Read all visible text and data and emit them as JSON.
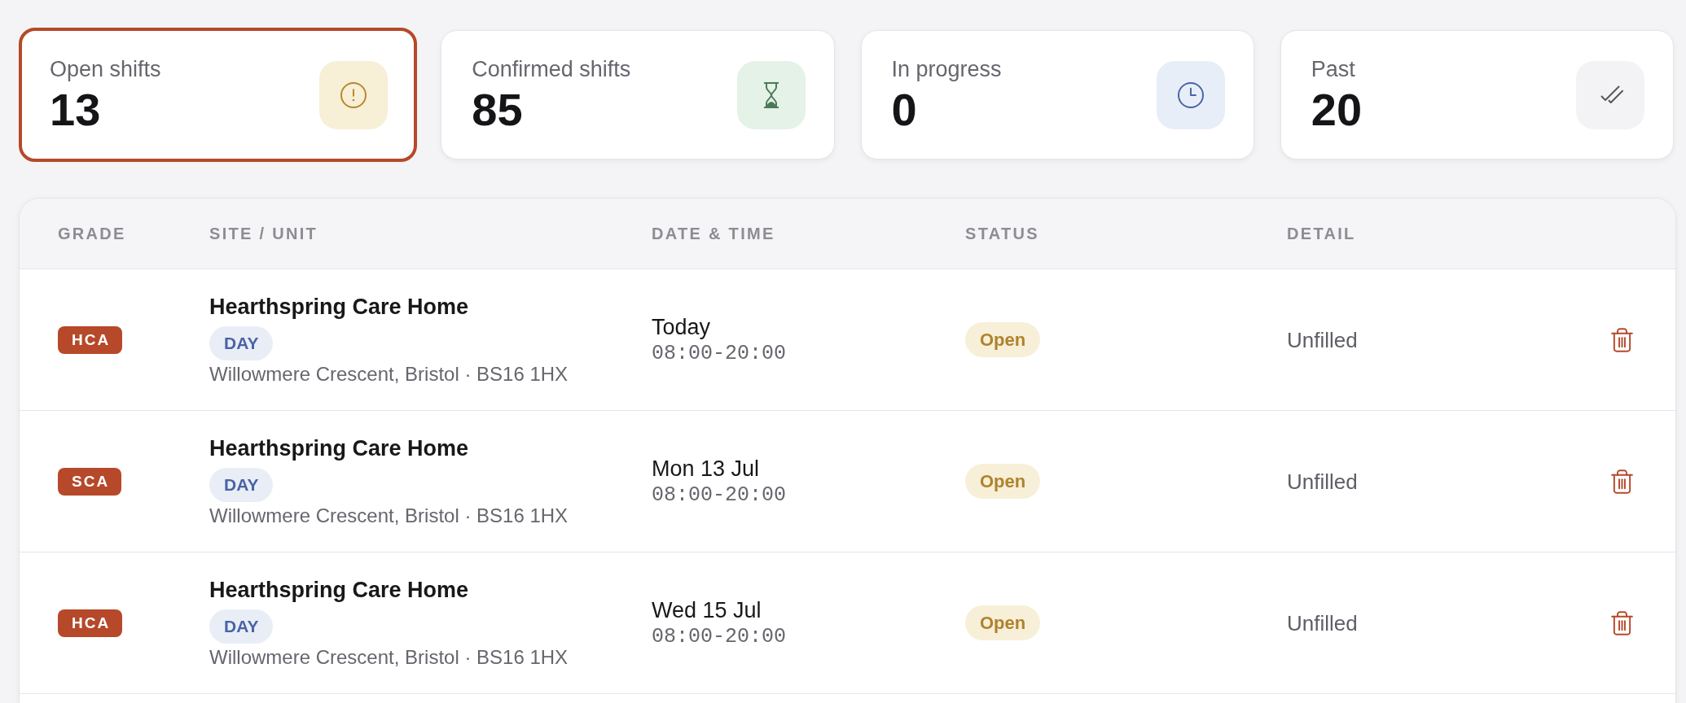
{
  "stat_cards": [
    {
      "kind": "alert",
      "label": "Open shifts",
      "count": "13",
      "selected": true
    },
    {
      "kind": "pending",
      "label": "Confirmed shifts",
      "count": "85",
      "selected": false
    },
    {
      "kind": "active",
      "label": "In progress",
      "count": "0",
      "selected": false
    },
    {
      "kind": "done",
      "label": "Past",
      "count": "20",
      "selected": false
    }
  ],
  "table": {
    "columns": [
      "GRADE",
      "SITE / UNIT",
      "DATE & TIME",
      "STATUS",
      "DETAIL"
    ],
    "rows": [
      {
        "grade": "HCA",
        "site": "Hearthspring Care Home",
        "unit": "DAY",
        "address": "Willowmere Crescent, Bristol · BS16 1HX",
        "date": "Today",
        "time": "08:00-20:00",
        "status": "Open",
        "detail": "Unfilled"
      },
      {
        "grade": "SCA",
        "site": "Hearthspring Care Home",
        "unit": "DAY",
        "address": "Willowmere Crescent, Bristol · BS16 1HX",
        "date": "Mon 13 Jul",
        "time": "08:00-20:00",
        "status": "Open",
        "detail": "Unfilled"
      },
      {
        "grade": "HCA",
        "site": "Hearthspring Care Home",
        "unit": "DAY",
        "address": "Willowmere Crescent, Bristol · BS16 1HX",
        "date": "Wed 15 Jul",
        "time": "08:00-20:00",
        "status": "Open",
        "detail": "Unfilled"
      }
    ]
  }
}
